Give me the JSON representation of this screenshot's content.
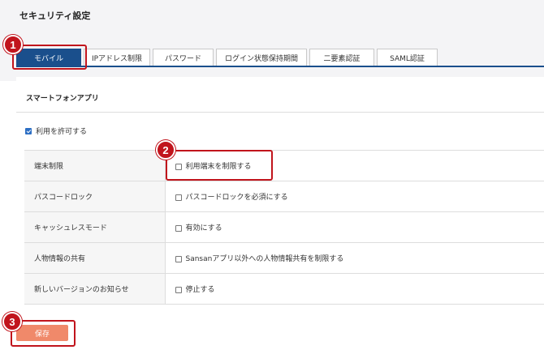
{
  "page": {
    "title": "セキュリティ設定"
  },
  "tabs": [
    {
      "label": "モバイル",
      "active": true
    },
    {
      "label": "IPアドレス制限",
      "active": false
    },
    {
      "label": "パスワード",
      "active": false
    },
    {
      "label": "ログイン状態保持期間",
      "active": false
    },
    {
      "label": "二要素認証",
      "active": false
    },
    {
      "label": "SAML認証",
      "active": false
    }
  ],
  "section": {
    "title": "スマートフォンアプリ",
    "allow": {
      "label": "利用を許可する",
      "checked": true
    }
  },
  "settings": [
    {
      "label": "端末制限",
      "option": "利用端末を制限する",
      "checked": false
    },
    {
      "label": "パスコードロック",
      "option": "パスコードロックを必須にする",
      "checked": false
    },
    {
      "label": "キャッシュレスモード",
      "option": "有効にする",
      "checked": false
    },
    {
      "label": "人物情報の共有",
      "option": "Sansanアプリ以外への人物情報共有を制限する",
      "checked": false
    },
    {
      "label": "新しいバージョンのお知らせ",
      "option": "停止する",
      "checked": false
    }
  ],
  "actions": {
    "save_label": "保存"
  },
  "annotations": [
    {
      "number": "1"
    },
    {
      "number": "2"
    },
    {
      "number": "3"
    }
  ],
  "colors": {
    "tab_active": "#1a4f8c",
    "save_button": "#f0896a",
    "callout": "#c1141c",
    "checkbox_checked": "#2d6fc4"
  }
}
